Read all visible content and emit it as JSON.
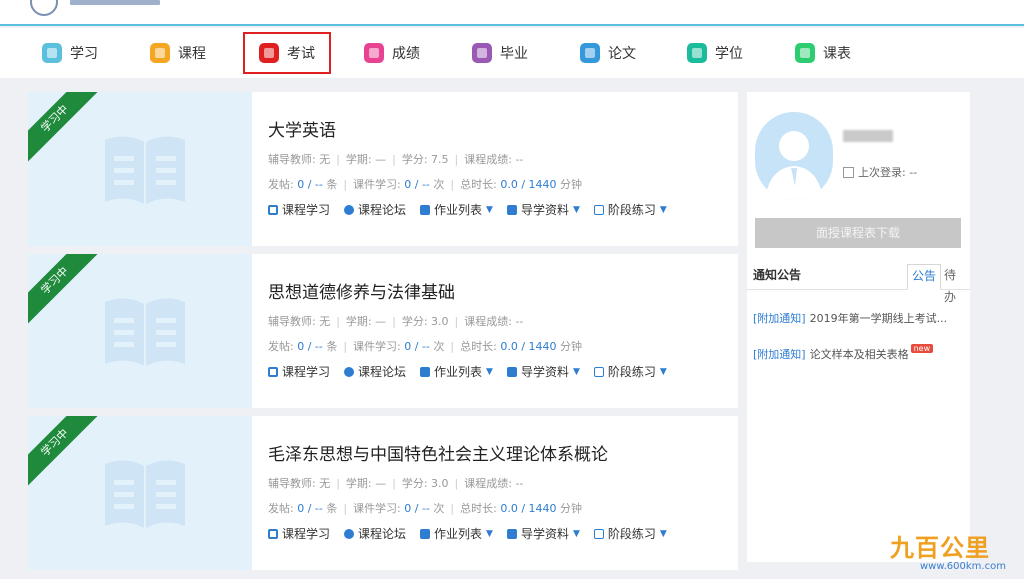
{
  "nav": {
    "items": [
      {
        "label": "学习",
        "icon": "study-icon",
        "color": "#5bc0de"
      },
      {
        "label": "课程",
        "icon": "course-icon",
        "color": "#f5a623"
      },
      {
        "label": "考试",
        "icon": "exam-icon",
        "color": "#e02020",
        "active": true
      },
      {
        "label": "成绩",
        "icon": "grades-icon",
        "color": "#e84393"
      },
      {
        "label": "毕业",
        "icon": "graduation-icon",
        "color": "#9b59b6"
      },
      {
        "label": "论文",
        "icon": "thesis-icon",
        "color": "#3498db"
      },
      {
        "label": "学位",
        "icon": "degree-cap-icon",
        "color": "#1abc9c"
      },
      {
        "label": "课表",
        "icon": "timetable-icon",
        "color": "#2ecc71"
      }
    ]
  },
  "courses": [
    {
      "status": "学习中",
      "title": "大学英语",
      "teacher_label": "辅导教师: 无",
      "term_label": "学期: —",
      "credit_label": "学分: 7.5",
      "grade_label": "课程成绩: --",
      "posts_label": "发帖: ",
      "posts_value": "0 / --",
      "posts_unit": "条",
      "study_label": "课件学习: ",
      "study_value": "0 / --",
      "study_unit": "次",
      "time_label": "总时长: ",
      "time_value": "0.0 / 1440",
      "time_unit": "分钟"
    },
    {
      "status": "学习中",
      "title": "思想道德修养与法律基础",
      "teacher_label": "辅导教师: 无",
      "term_label": "学期: —",
      "credit_label": "学分: 3.0",
      "grade_label": "课程成绩: --",
      "posts_label": "发帖: ",
      "posts_value": "0 / --",
      "posts_unit": "条",
      "study_label": "课件学习: ",
      "study_value": "0 / --",
      "study_unit": "次",
      "time_label": "总时长: ",
      "time_value": "0.0 / 1440",
      "time_unit": "分钟"
    },
    {
      "status": "学习中",
      "title": "毛泽东思想与中国特色社会主义理论体系概论",
      "teacher_label": "辅导教师: 无",
      "term_label": "学期: —",
      "credit_label": "学分: 3.0",
      "grade_label": "课程成绩: --",
      "posts_label": "发帖: ",
      "posts_value": "0 / --",
      "posts_unit": "条",
      "study_label": "课件学习: ",
      "study_value": "0 / --",
      "study_unit": "次",
      "time_label": "总时长: ",
      "time_value": "0.0 / 1440",
      "time_unit": "分钟"
    }
  ],
  "course_links": {
    "study": "课程学习",
    "forum": "课程论坛",
    "homework": "作业列表",
    "guide": "导学资料",
    "practice": "阶段练习"
  },
  "sidebar": {
    "last_login_label": "上次登录: --",
    "download_button": "面授课程表下载",
    "notice_title": "通知公告",
    "tab_notice": "公告",
    "tab_todo": "待办",
    "notices": [
      {
        "tag": "[附加通知]",
        "text": "2019年第一学期线上考试..."
      },
      {
        "tag": "[附加通知]",
        "text": "论文样本及相关表格",
        "badge": "new"
      }
    ]
  },
  "watermark": {
    "brand": "百公里",
    "url": "www.600km.com"
  },
  "colors": {
    "accent": "#2e7dd1",
    "ribbon": "#1f8a3c",
    "active_border": "#e02020",
    "top_line": "#5bc0de"
  }
}
